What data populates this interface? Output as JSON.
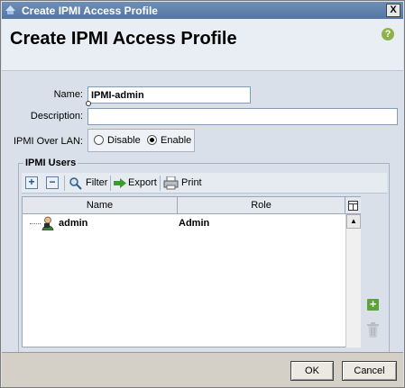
{
  "window": {
    "title": "Create IPMI Access Profile",
    "close_label": "X"
  },
  "header": {
    "title": "Create IPMI Access Profile",
    "help_label": "?"
  },
  "form": {
    "name_label": "Name:",
    "name_value": "IPMI-admin",
    "description_label": "Description:",
    "description_value": "",
    "lan_label": "IPMI Over LAN:",
    "lan_options": [
      {
        "label": "Disable",
        "checked": false
      },
      {
        "label": "Enable",
        "checked": true
      }
    ]
  },
  "users": {
    "group_label": "IPMI Users",
    "toolbar": {
      "add_label": "+",
      "remove_label": "−",
      "filter_label": "Filter",
      "export_label": "Export",
      "print_label": "Print"
    },
    "columns": [
      "Name",
      "Role"
    ],
    "rows": [
      {
        "name": "admin",
        "role": "Admin"
      }
    ]
  },
  "footer": {
    "ok_label": "OK",
    "cancel_label": "Cancel"
  },
  "colors": {
    "titlebar": "#5476a3",
    "accent_green": "#5ba33a"
  }
}
